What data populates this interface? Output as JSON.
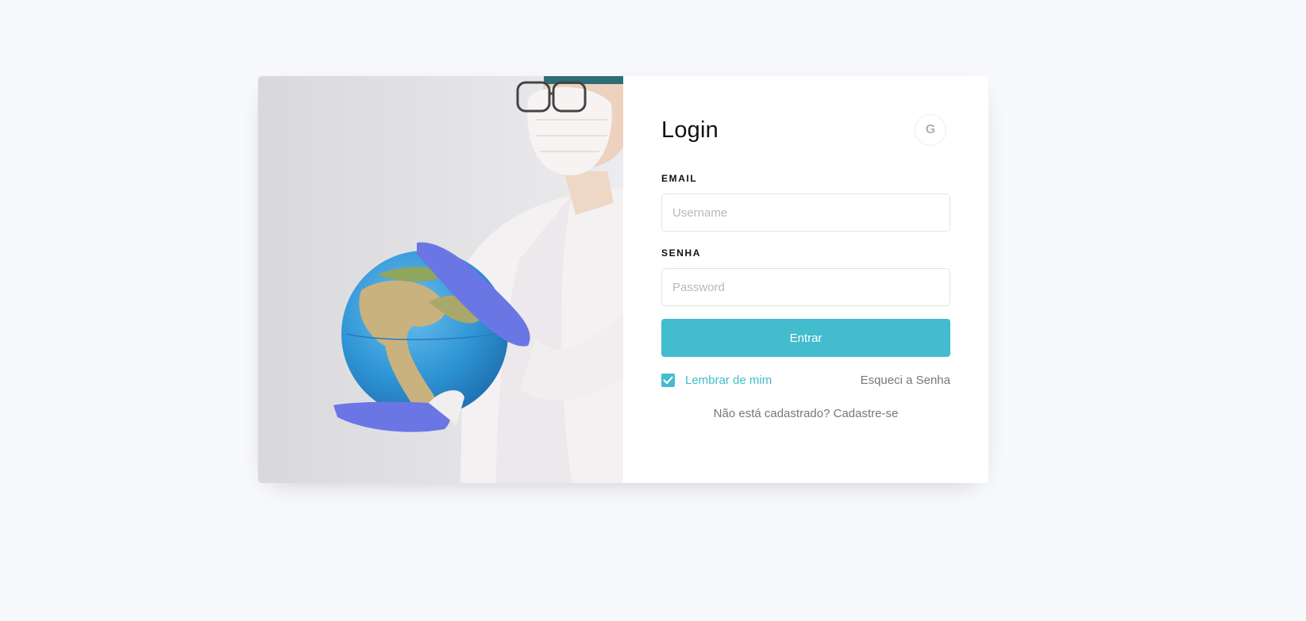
{
  "login": {
    "title": "Login",
    "social_google_label": "G",
    "email_label": "EMAIL",
    "email_placeholder": "Username",
    "password_label": "SENHA",
    "password_placeholder": "Password",
    "submit_label": "Entrar",
    "remember_label": "Lembrar de mim",
    "remember_checked": true,
    "forgot_label": "Esqueci a Senha",
    "register_prompt": "Não está cadastrado?",
    "register_link": "Cadastre-se"
  },
  "colors": {
    "accent": "#43bccd",
    "background": "#f8f9fd",
    "card": "#ffffff"
  },
  "icons": {
    "social": "google-icon",
    "checkbox": "check-icon"
  }
}
